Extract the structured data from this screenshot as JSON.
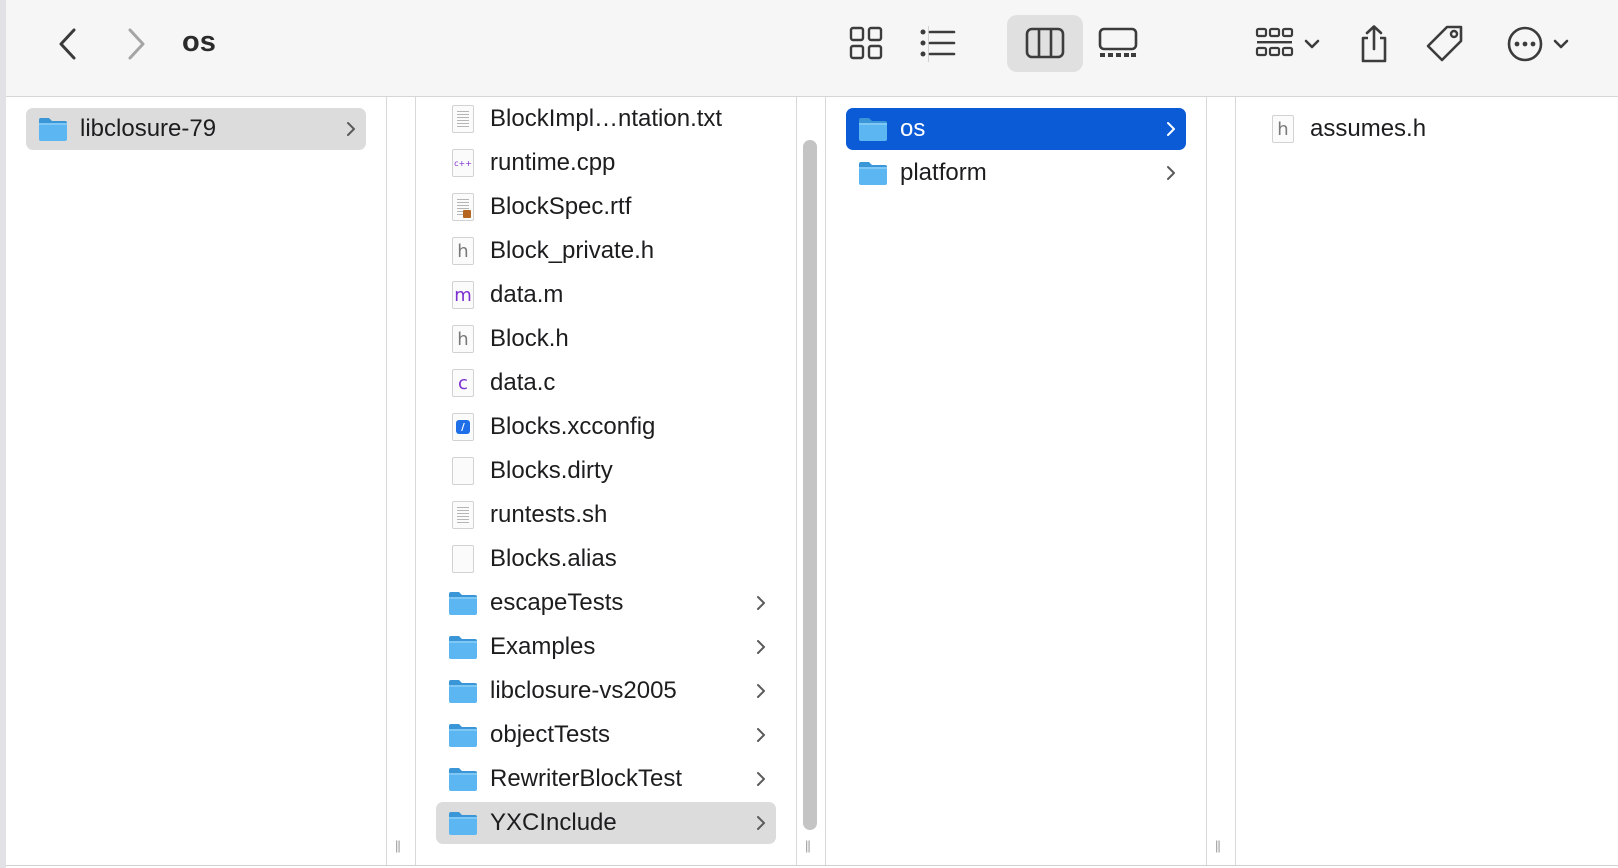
{
  "window": {
    "title": "os"
  },
  "toolbar": {
    "back_icon": "chevron-left-icon",
    "forward_icon": "chevron-right-icon",
    "view_modes": [
      "icon-view-icon",
      "list-view-icon",
      "column-view-icon",
      "gallery-view-icon"
    ],
    "selected_view": "column-view-icon",
    "actions": [
      "group-icon",
      "share-icon",
      "tag-icon",
      "more-icon"
    ]
  },
  "columns": {
    "col1": [
      {
        "label": "libclosure-79",
        "type": "folder",
        "selected": "gray",
        "has_children": true
      }
    ],
    "col2": [
      {
        "label": "BlockImpl…ntation.txt",
        "type": "txt"
      },
      {
        "label": "runtime.cpp",
        "type": "cpp",
        "badge": "c++"
      },
      {
        "label": "BlockSpec.rtf",
        "type": "rtf"
      },
      {
        "label": "Block_private.h",
        "type": "h",
        "badge": "h"
      },
      {
        "label": "data.m",
        "type": "m",
        "badge": "m"
      },
      {
        "label": "Block.h",
        "type": "h",
        "badge": "h"
      },
      {
        "label": "data.c",
        "type": "c",
        "badge": "c"
      },
      {
        "label": "Blocks.xcconfig",
        "type": "xcconfig"
      },
      {
        "label": "Blocks.dirty",
        "type": "blank"
      },
      {
        "label": "runtests.sh",
        "type": "txt"
      },
      {
        "label": "Blocks.alias",
        "type": "blank"
      },
      {
        "label": "escapeTests",
        "type": "folder",
        "has_children": true
      },
      {
        "label": "Examples",
        "type": "folder",
        "has_children": true
      },
      {
        "label": "libclosure-vs2005",
        "type": "folder",
        "has_children": true
      },
      {
        "label": "objectTests",
        "type": "folder",
        "has_children": true
      },
      {
        "label": "RewriterBlockTest",
        "type": "folder",
        "has_children": true
      },
      {
        "label": "YXCInclude",
        "type": "folder",
        "selected": "gray",
        "has_children": true
      }
    ],
    "col3": [
      {
        "label": "os",
        "type": "folder",
        "selected": "blue",
        "has_children": true
      },
      {
        "label": "platform",
        "type": "folder",
        "has_children": true
      }
    ],
    "col4": [
      {
        "label": "assumes.h",
        "type": "h",
        "badge": "h"
      }
    ]
  },
  "colors": {
    "selection_blue": "#0b5ad6",
    "selection_gray": "#dcdcdc",
    "folder_blue": "#5bb6f2",
    "source_purple": "#7b2fd0"
  }
}
